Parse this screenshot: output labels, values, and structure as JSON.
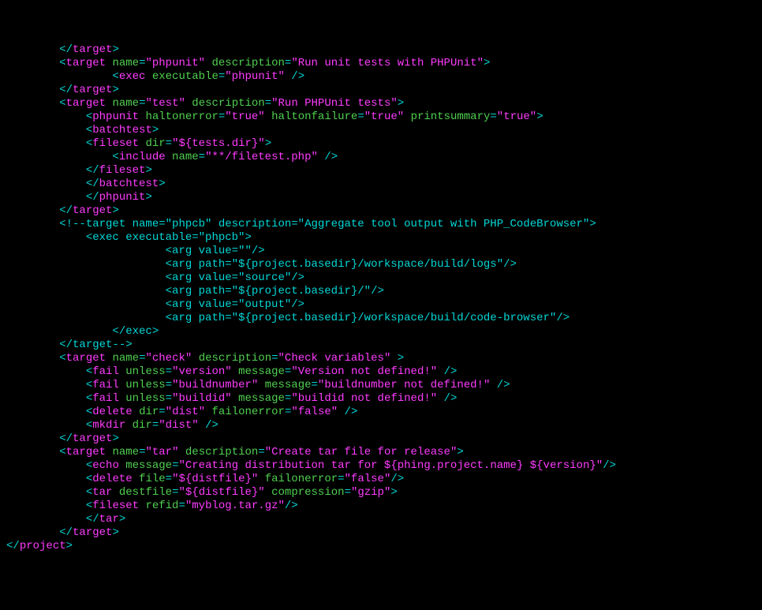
{
  "lines": [
    [
      [
        "        ",
        "w"
      ],
      [
        "</",
        "cyan"
      ],
      [
        "target",
        "mag"
      ],
      [
        ">",
        "cyan"
      ]
    ],
    [
      [
        "        ",
        "w"
      ],
      [
        "<",
        "cyan"
      ],
      [
        "target",
        "mag"
      ],
      [
        " ",
        "w"
      ],
      [
        "name",
        "grn"
      ],
      [
        "=",
        "cyan"
      ],
      [
        "\"phpunit\"",
        "mag"
      ],
      [
        " ",
        "w"
      ],
      [
        "description",
        "grn"
      ],
      [
        "=",
        "cyan"
      ],
      [
        "\"Run unit tests with PHPUnit\"",
        "mag"
      ],
      [
        ">",
        "cyan"
      ]
    ],
    [
      [
        "                ",
        "w"
      ],
      [
        "<",
        "cyan"
      ],
      [
        "exec",
        "mag"
      ],
      [
        " ",
        "w"
      ],
      [
        "executable",
        "grn"
      ],
      [
        "=",
        "cyan"
      ],
      [
        "\"phpunit\"",
        "mag"
      ],
      [
        " />",
        "cyan"
      ]
    ],
    [
      [
        "        ",
        "w"
      ],
      [
        "</",
        "cyan"
      ],
      [
        "target",
        "mag"
      ],
      [
        ">",
        "cyan"
      ]
    ],
    [
      [
        "        ",
        "w"
      ],
      [
        "<",
        "cyan"
      ],
      [
        "target",
        "mag"
      ],
      [
        " ",
        "w"
      ],
      [
        "name",
        "grn"
      ],
      [
        "=",
        "cyan"
      ],
      [
        "\"test\"",
        "mag"
      ],
      [
        " ",
        "w"
      ],
      [
        "description",
        "grn"
      ],
      [
        "=",
        "cyan"
      ],
      [
        "\"Run PHPUnit tests\"",
        "mag"
      ],
      [
        ">",
        "cyan"
      ]
    ],
    [
      [
        "            ",
        "w"
      ],
      [
        "<",
        "cyan"
      ],
      [
        "phpunit",
        "mag"
      ],
      [
        " ",
        "w"
      ],
      [
        "haltonerror",
        "grn"
      ],
      [
        "=",
        "cyan"
      ],
      [
        "\"true\"",
        "mag"
      ],
      [
        " ",
        "w"
      ],
      [
        "haltonfailure",
        "grn"
      ],
      [
        "=",
        "cyan"
      ],
      [
        "\"true\"",
        "mag"
      ],
      [
        " ",
        "w"
      ],
      [
        "printsummary",
        "grn"
      ],
      [
        "=",
        "cyan"
      ],
      [
        "\"true\"",
        "mag"
      ],
      [
        ">",
        "cyan"
      ]
    ],
    [
      [
        "            ",
        "w"
      ],
      [
        "<",
        "cyan"
      ],
      [
        "batchtest",
        "mag"
      ],
      [
        ">",
        "cyan"
      ]
    ],
    [
      [
        "            ",
        "w"
      ],
      [
        "<",
        "cyan"
      ],
      [
        "fileset",
        "mag"
      ],
      [
        " ",
        "w"
      ],
      [
        "dir",
        "grn"
      ],
      [
        "=",
        "cyan"
      ],
      [
        "\"${tests.dir}\"",
        "mag"
      ],
      [
        ">",
        "cyan"
      ]
    ],
    [
      [
        "                ",
        "w"
      ],
      [
        "<",
        "cyan"
      ],
      [
        "include",
        "mag"
      ],
      [
        " ",
        "w"
      ],
      [
        "name",
        "grn"
      ],
      [
        "=",
        "cyan"
      ],
      [
        "\"**/filetest.php\"",
        "mag"
      ],
      [
        " />",
        "cyan"
      ]
    ],
    [
      [
        "            ",
        "w"
      ],
      [
        "</",
        "cyan"
      ],
      [
        "fileset",
        "mag"
      ],
      [
        ">",
        "cyan"
      ]
    ],
    [
      [
        "            ",
        "w"
      ],
      [
        "</",
        "cyan"
      ],
      [
        "batchtest",
        "mag"
      ],
      [
        ">",
        "cyan"
      ]
    ],
    [
      [
        "            ",
        "w"
      ],
      [
        "</",
        "cyan"
      ],
      [
        "phpunit",
        "mag"
      ],
      [
        ">",
        "cyan"
      ]
    ],
    [
      [
        "        ",
        "w"
      ],
      [
        "</",
        "cyan"
      ],
      [
        "target",
        "mag"
      ],
      [
        ">",
        "cyan"
      ]
    ],
    [
      [
        "        ",
        "w"
      ],
      [
        "<!--target name=\"phpcb\" description=\"Aggregate tool output with PHP_CodeBrowser\">",
        "cyan"
      ]
    ],
    [
      [
        "            <exec executable=\"phpcb\">",
        "cyan"
      ]
    ],
    [
      [
        "                        <arg value=\"\"/>",
        "cyan"
      ]
    ],
    [
      [
        "                        <arg path=\"${project.basedir}/workspace/build/logs\"/>",
        "cyan"
      ]
    ],
    [
      [
        "                        <arg value=\"source\"/>",
        "cyan"
      ]
    ],
    [
      [
        "                        <arg path=\"${project.basedir}/\"/>",
        "cyan"
      ]
    ],
    [
      [
        "                        <arg value=\"output\"/>",
        "cyan"
      ]
    ],
    [
      [
        "                        <arg path=\"${project.basedir}/workspace/build/code-browser\"/>",
        "cyan"
      ]
    ],
    [
      [
        "                </exec>",
        "cyan"
      ]
    ],
    [
      [
        "        </target-->",
        "cyan"
      ]
    ],
    [
      [
        "        ",
        "w"
      ],
      [
        "<",
        "cyan"
      ],
      [
        "target",
        "mag"
      ],
      [
        " ",
        "w"
      ],
      [
        "name",
        "grn"
      ],
      [
        "=",
        "cyan"
      ],
      [
        "\"check\"",
        "mag"
      ],
      [
        " ",
        "w"
      ],
      [
        "description",
        "grn"
      ],
      [
        "=",
        "cyan"
      ],
      [
        "\"Check variables\"",
        "mag"
      ],
      [
        " >",
        "cyan"
      ]
    ],
    [
      [
        "            ",
        "w"
      ],
      [
        "<",
        "cyan"
      ],
      [
        "fail",
        "mag"
      ],
      [
        " ",
        "w"
      ],
      [
        "unless",
        "grn"
      ],
      [
        "=",
        "cyan"
      ],
      [
        "\"version\"",
        "mag"
      ],
      [
        " ",
        "w"
      ],
      [
        "message",
        "grn"
      ],
      [
        "=",
        "cyan"
      ],
      [
        "\"Version not defined!\"",
        "mag"
      ],
      [
        " />",
        "cyan"
      ]
    ],
    [
      [
        "            ",
        "w"
      ],
      [
        "<",
        "cyan"
      ],
      [
        "fail",
        "mag"
      ],
      [
        " ",
        "w"
      ],
      [
        "unless",
        "grn"
      ],
      [
        "=",
        "cyan"
      ],
      [
        "\"buildnumber\"",
        "mag"
      ],
      [
        " ",
        "w"
      ],
      [
        "message",
        "grn"
      ],
      [
        "=",
        "cyan"
      ],
      [
        "\"buildnumber not defined!\"",
        "mag"
      ],
      [
        " />",
        "cyan"
      ]
    ],
    [
      [
        "            ",
        "w"
      ],
      [
        "<",
        "cyan"
      ],
      [
        "fail",
        "mag"
      ],
      [
        " ",
        "w"
      ],
      [
        "unless",
        "grn"
      ],
      [
        "=",
        "cyan"
      ],
      [
        "\"buildid\"",
        "mag"
      ],
      [
        " ",
        "w"
      ],
      [
        "message",
        "grn"
      ],
      [
        "=",
        "cyan"
      ],
      [
        "\"buildid not defined!\"",
        "mag"
      ],
      [
        " />",
        "cyan"
      ]
    ],
    [
      [
        "            ",
        "w"
      ],
      [
        "<",
        "cyan"
      ],
      [
        "delete",
        "mag"
      ],
      [
        " ",
        "w"
      ],
      [
        "dir",
        "grn"
      ],
      [
        "=",
        "cyan"
      ],
      [
        "\"dist\"",
        "mag"
      ],
      [
        " ",
        "w"
      ],
      [
        "failonerror",
        "grn"
      ],
      [
        "=",
        "cyan"
      ],
      [
        "\"false\"",
        "mag"
      ],
      [
        " />",
        "cyan"
      ]
    ],
    [
      [
        "            ",
        "w"
      ],
      [
        "<",
        "cyan"
      ],
      [
        "mkdir",
        "mag"
      ],
      [
        " ",
        "w"
      ],
      [
        "dir",
        "grn"
      ],
      [
        "=",
        "cyan"
      ],
      [
        "\"dist\"",
        "mag"
      ],
      [
        " />",
        "cyan"
      ]
    ],
    [
      [
        "        ",
        "w"
      ],
      [
        "</",
        "cyan"
      ],
      [
        "target",
        "mag"
      ],
      [
        ">",
        "cyan"
      ]
    ],
    [
      [
        "        ",
        "w"
      ],
      [
        "<",
        "cyan"
      ],
      [
        "target",
        "mag"
      ],
      [
        " ",
        "w"
      ],
      [
        "name",
        "grn"
      ],
      [
        "=",
        "cyan"
      ],
      [
        "\"tar\"",
        "mag"
      ],
      [
        " ",
        "w"
      ],
      [
        "description",
        "grn"
      ],
      [
        "=",
        "cyan"
      ],
      [
        "\"Create tar file for release\"",
        "mag"
      ],
      [
        ">",
        "cyan"
      ]
    ],
    [
      [
        "            ",
        "w"
      ],
      [
        "<",
        "cyan"
      ],
      [
        "echo",
        "mag"
      ],
      [
        " ",
        "w"
      ],
      [
        "message",
        "grn"
      ],
      [
        "=",
        "cyan"
      ],
      [
        "\"Creating distribution tar for ${phing.project.name} ${version}\"",
        "mag"
      ],
      [
        "/>",
        "cyan"
      ]
    ],
    [
      [
        "            ",
        "w"
      ],
      [
        "<",
        "cyan"
      ],
      [
        "delete",
        "mag"
      ],
      [
        " ",
        "w"
      ],
      [
        "file",
        "grn"
      ],
      [
        "=",
        "cyan"
      ],
      [
        "\"${distfile}\"",
        "mag"
      ],
      [
        " ",
        "w"
      ],
      [
        "failonerror",
        "grn"
      ],
      [
        "=",
        "cyan"
      ],
      [
        "\"false\"",
        "mag"
      ],
      [
        "/>",
        "cyan"
      ]
    ],
    [
      [
        "            ",
        "w"
      ],
      [
        "<",
        "cyan"
      ],
      [
        "tar",
        "mag"
      ],
      [
        " ",
        "w"
      ],
      [
        "destfile",
        "grn"
      ],
      [
        "=",
        "cyan"
      ],
      [
        "\"${distfile}\"",
        "mag"
      ],
      [
        " ",
        "w"
      ],
      [
        "compression",
        "grn"
      ],
      [
        "=",
        "cyan"
      ],
      [
        "\"gzip\"",
        "mag"
      ],
      [
        ">",
        "cyan"
      ]
    ],
    [
      [
        "            ",
        "w"
      ],
      [
        "<",
        "cyan"
      ],
      [
        "fileset",
        "mag"
      ],
      [
        " ",
        "w"
      ],
      [
        "refid",
        "grn"
      ],
      [
        "=",
        "cyan"
      ],
      [
        "\"myblog.tar.gz\"",
        "mag"
      ],
      [
        "/>",
        "cyan"
      ]
    ],
    [
      [
        "            ",
        "w"
      ],
      [
        "</",
        "cyan"
      ],
      [
        "tar",
        "mag"
      ],
      [
        ">",
        "cyan"
      ]
    ],
    [
      [
        "        ",
        "w"
      ],
      [
        "</",
        "cyan"
      ],
      [
        "target",
        "mag"
      ],
      [
        ">",
        "cyan"
      ]
    ],
    [
      [
        "</",
        "cyan"
      ],
      [
        "project",
        "mag"
      ],
      [
        ">",
        "cyan"
      ]
    ]
  ]
}
